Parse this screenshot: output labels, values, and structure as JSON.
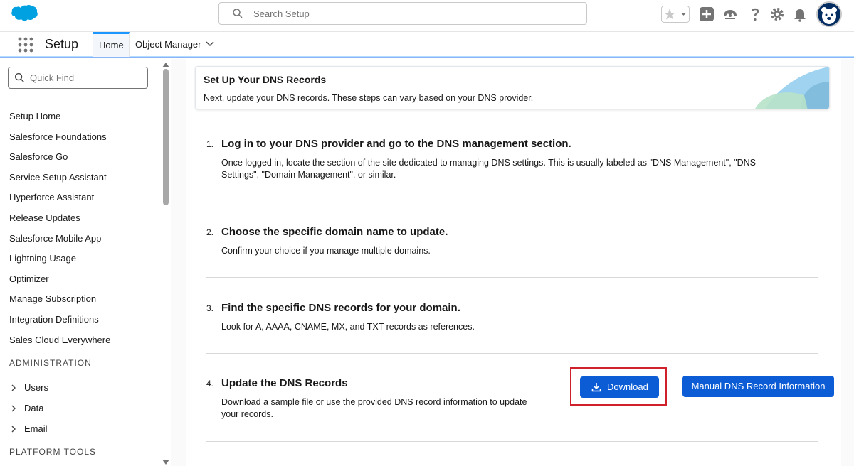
{
  "header": {
    "search_placeholder": "Search Setup"
  },
  "context_bar": {
    "app_name": "Setup",
    "tabs": [
      {
        "label": "Home",
        "active": true
      },
      {
        "label": "Object Manager",
        "active": false
      }
    ]
  },
  "sidebar": {
    "quickfind_placeholder": "Quick Find",
    "items": [
      "Setup Home",
      "Salesforce Foundations",
      "Salesforce Go",
      "Service Setup Assistant",
      "Hyperforce Assistant",
      "Release Updates",
      "Salesforce Mobile App",
      "Lightning Usage",
      "Optimizer",
      "Manage Subscription",
      "Integration Definitions",
      "Sales Cloud Everywhere"
    ],
    "section_admin": "ADMINISTRATION",
    "admin_items": [
      "Users",
      "Data",
      "Email"
    ],
    "section_platform": "PLATFORM TOOLS"
  },
  "banner": {
    "title": "Set Up Your DNS Records",
    "subtitle": "Next, update your DNS records. These steps can vary based on your DNS provider."
  },
  "steps": [
    {
      "number": "1.",
      "title": "Log in to your DNS provider and go to the DNS management section.",
      "desc_line1": "Once logged in, locate the section of the site dedicated to managing DNS settings. This is usually labeled as \"DNS Management\", \"DNS",
      "desc_line2": "Settings\", \"Domain Management\", or similar."
    },
    {
      "number": "2.",
      "title": "Choose the specific domain name to update.",
      "desc_line1": "Confirm your choice if you manage multiple domains."
    },
    {
      "number": "3.",
      "title": "Find the specific DNS records for your domain.",
      "desc_line1": "Look for A, AAAA, CNAME, MX, and TXT records as references."
    },
    {
      "number": "4.",
      "title": "Update the DNS Records",
      "desc_line1": "Download a sample file or use the provided DNS record information to update",
      "desc_line2": "your records."
    }
  ],
  "actions": {
    "download_label": "Download",
    "manual_label": "Manual DNS Record Information"
  },
  "colors": {
    "brand_blue": "#0b5cd5",
    "cloud_blue": "#00a1e0",
    "highlight_red": "#d0202c"
  }
}
